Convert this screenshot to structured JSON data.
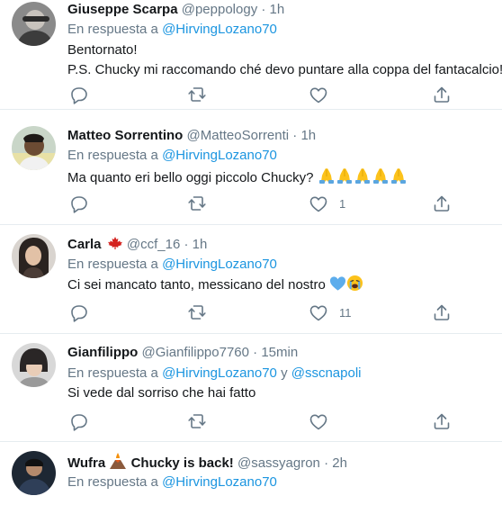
{
  "tweets": [
    {
      "name": "Giuseppe Scarpa",
      "handle": "@peppology",
      "sep": "·",
      "time": "1h",
      "reply_prefix": "En respuesta a",
      "mention1": "@HirvingLozano70",
      "text_lines": [
        "Bentornato!",
        "P.S. Chucky mi raccomando ché devo puntare alla coppa del fantacalcio!"
      ],
      "likes": ""
    },
    {
      "name": "Matteo Sorrentino",
      "handle": "@MatteoSorrenti",
      "sep": "·",
      "time": "1h",
      "reply_prefix": "En respuesta a",
      "mention1": "@HirvingLozano70",
      "text_lines": [
        "Ma quanto eri bello oggi piccolo Chucky?"
      ],
      "emoji": [
        "folded-hands-emoji",
        "folded-hands-emoji",
        "folded-hands-emoji",
        "folded-hands-emoji",
        "folded-hands-emoji"
      ],
      "likes": "1"
    },
    {
      "name": "Carla",
      "name_emoji": "maple-leaf-flag-icon",
      "handle": "@ccf_16",
      "sep": "·",
      "time": "1h",
      "reply_prefix": "En respuesta a",
      "mention1": "@HirvingLozano70",
      "text_lines": [
        "Ci sei mancato tanto, messicano del nostro"
      ],
      "emoji": [
        "blue-heart-emoji",
        "crying-face-emoji"
      ],
      "likes": "11"
    },
    {
      "name": "Gianfilippo",
      "handle": "@Gianfilippo7760",
      "sep": "·",
      "time": "15min",
      "reply_prefix": "En respuesta a",
      "mention1": "@HirvingLozano70",
      "conj": "y",
      "mention2": "@sscnapoli",
      "text_lines": [
        "Si vede dal sorriso che hai fatto"
      ],
      "likes": ""
    },
    {
      "name": "Wufra",
      "name_emoji": "volcano-emoji",
      "name_suffix": "Chucky is back!",
      "handle": "@sassyagron",
      "sep": "·",
      "time": "2h",
      "reply_prefix": "En respuesta a",
      "mention1": "@HirvingLozano70",
      "text_lines": [],
      "likes": ""
    }
  ],
  "icons": [
    "reply-icon",
    "retweet-icon",
    "like-icon",
    "share-icon"
  ],
  "colors": {
    "name": "#14171a",
    "secondary": "#657786",
    "link": "#1b95e0",
    "divider": "#e6ecf0",
    "icon": "#657786"
  }
}
